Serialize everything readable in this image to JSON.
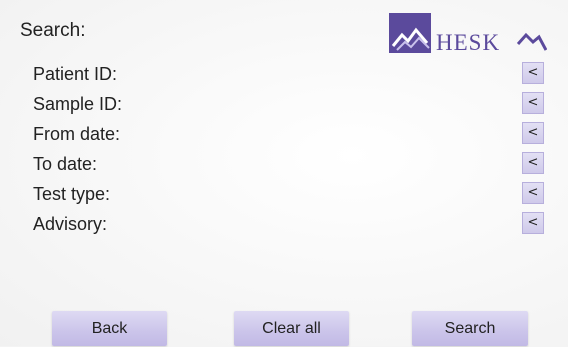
{
  "header": {
    "title": "Search:",
    "logo_text": "HESK"
  },
  "fields": [
    {
      "label": "Patient ID:",
      "button": "<"
    },
    {
      "label": "Sample ID:",
      "button": "<"
    },
    {
      "label": "From date:",
      "button": "<"
    },
    {
      "label": "To date:",
      "button": "<"
    },
    {
      "label": "Test type:",
      "button": "<"
    },
    {
      "label": "Advisory:",
      "button": "<"
    }
  ],
  "footer": {
    "back_label": "Back",
    "clear_label": "Clear all",
    "search_label": "Search"
  },
  "colors": {
    "brand": "#5b4a9c",
    "button_face": "#cbc4ea",
    "background": "#f4f4f4"
  }
}
